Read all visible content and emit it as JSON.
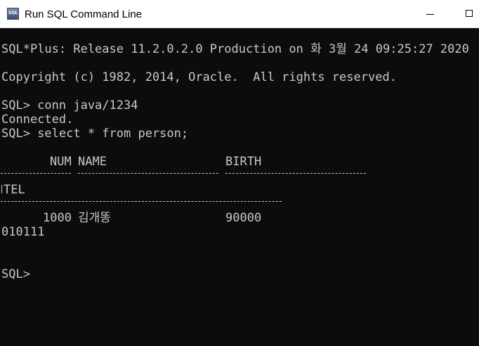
{
  "window": {
    "title": "Run SQL Command Line",
    "icon": "sqlplus-app-icon",
    "icon_text": "SQL",
    "controls": [
      "minimize-icon",
      "maximize-icon"
    ]
  },
  "console": {
    "release_line": "SQL*Plus: Release 11.2.0.2.0 Production on 화 3월 24 09:25:27 2020",
    "copyright_line": "Copyright (c) 1982, 2014, Oracle.  All rights reserved.",
    "connect_command": "SQL> conn java/1234",
    "connected_message": "Connected.",
    "select_command": "SQL> select * from person;",
    "columns": {
      "num": "NUM",
      "name": "NAME",
      "birth": "BIRTH",
      "tel": "TEL"
    },
    "row": {
      "num": "1000",
      "name": "김개똥",
      "birth": "90000",
      "tel": "010111"
    },
    "prompt": "SQL>"
  },
  "colors": {
    "console_background": "#0c0c0c",
    "console_text": "#c8c8c8",
    "titlebar_background": "#ffffff"
  }
}
